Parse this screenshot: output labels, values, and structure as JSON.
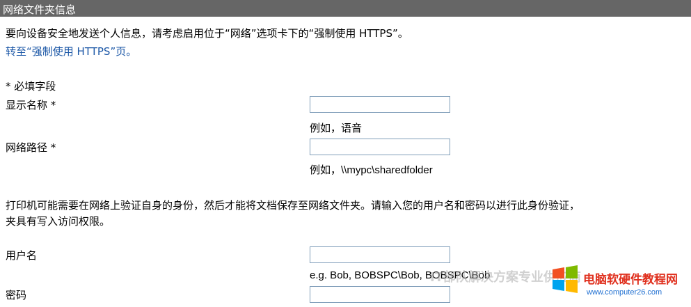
{
  "header": {
    "title": "网络文件夹信息"
  },
  "intro": {
    "text": "要向设备安全地发送个人信息，请考虑启用位于“网络”选项卡下的“强制使用 HTTPS”。",
    "link": "转至“强制使用 HTTPS”页。"
  },
  "required_note": "* 必填字段",
  "fields": {
    "display_name": {
      "label": "显示名称 *",
      "value": "",
      "example": "例如，语音"
    },
    "network_path": {
      "label": "网络路径 *",
      "value": "",
      "example": "例如，\\\\mypc\\sharedfolder"
    }
  },
  "auth_note": {
    "line1": "打印机可能需要在网络上验证自身的身份，然后才能将文档保存至网络文件夹。请输入您的用户名和密码以进行此身份验证，",
    "line2": "夹具有写入访问权限。"
  },
  "credentials": {
    "username": {
      "label": "用户名",
      "value": "",
      "example": "e.g. Bob, BOBSPC\\Bob, BOBSPC\\Bob"
    },
    "password": {
      "label": "密码",
      "value": ""
    }
  },
  "watermark": {
    "site_name": "电脑软硬件教程网",
    "site_url": "www.computer26.com",
    "overlay_text": "IT部队解决方案专业供应商"
  }
}
